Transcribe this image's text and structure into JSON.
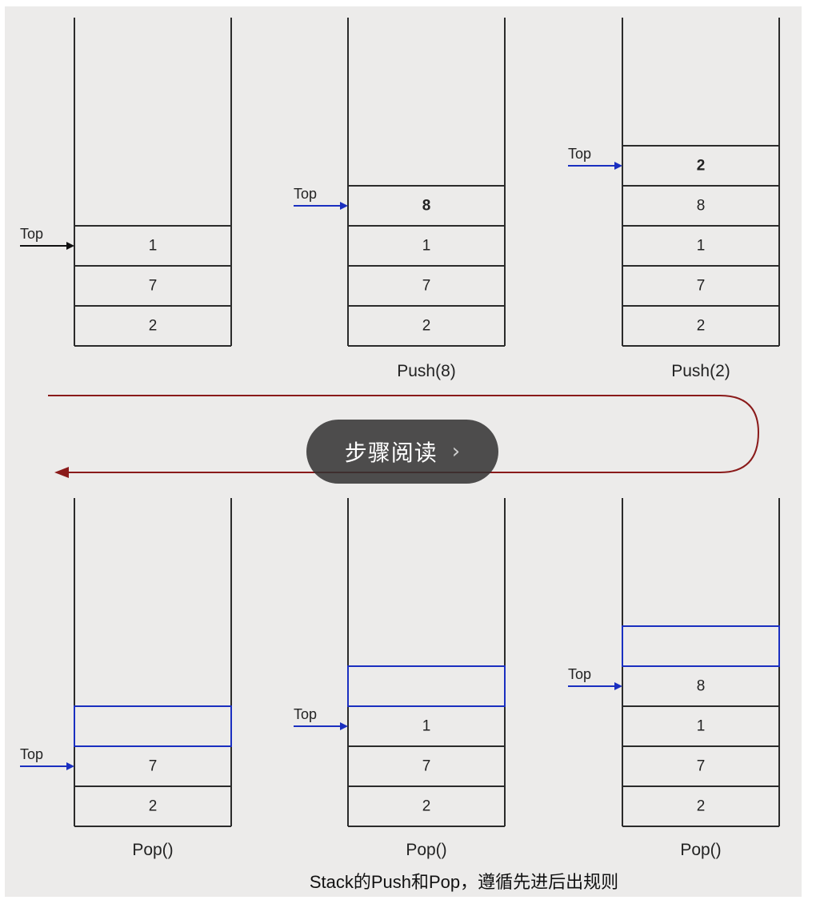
{
  "diagram": {
    "top_label": "Top",
    "stacks": [
      {
        "id": "s1",
        "cells": [
          "2",
          "7",
          "1"
        ],
        "highlight": null,
        "operation": ""
      },
      {
        "id": "s2",
        "cells": [
          "2",
          "7",
          "1",
          "8"
        ],
        "highlight": null,
        "operation": "Push(8)"
      },
      {
        "id": "s3",
        "cells": [
          "2",
          "7",
          "1",
          "8",
          "2"
        ],
        "highlight": null,
        "operation": "Push(2)"
      },
      {
        "id": "s4",
        "cells": [
          "2",
          "7",
          ""
        ],
        "highlight": "removed",
        "operation": "Pop()"
      },
      {
        "id": "s5",
        "cells": [
          "2",
          "7",
          "1",
          ""
        ],
        "highlight": "removed",
        "operation": "Pop()"
      },
      {
        "id": "s6",
        "cells": [
          "2",
          "7",
          "1",
          "8",
          ""
        ],
        "highlight": "removed",
        "operation": "Pop()"
      }
    ],
    "caption": "Stack的Push和Pop，遵循先进后出规则",
    "colors": {
      "frame": "#ecebea",
      "lines": "#2b2b2b",
      "pointer_blue": "#1a2fc0",
      "pointer_black": "#111111",
      "flow_arrow": "#8a1a1a"
    }
  },
  "reader_button": {
    "label": "步骤阅读",
    "icon": "chevron-right-icon"
  }
}
